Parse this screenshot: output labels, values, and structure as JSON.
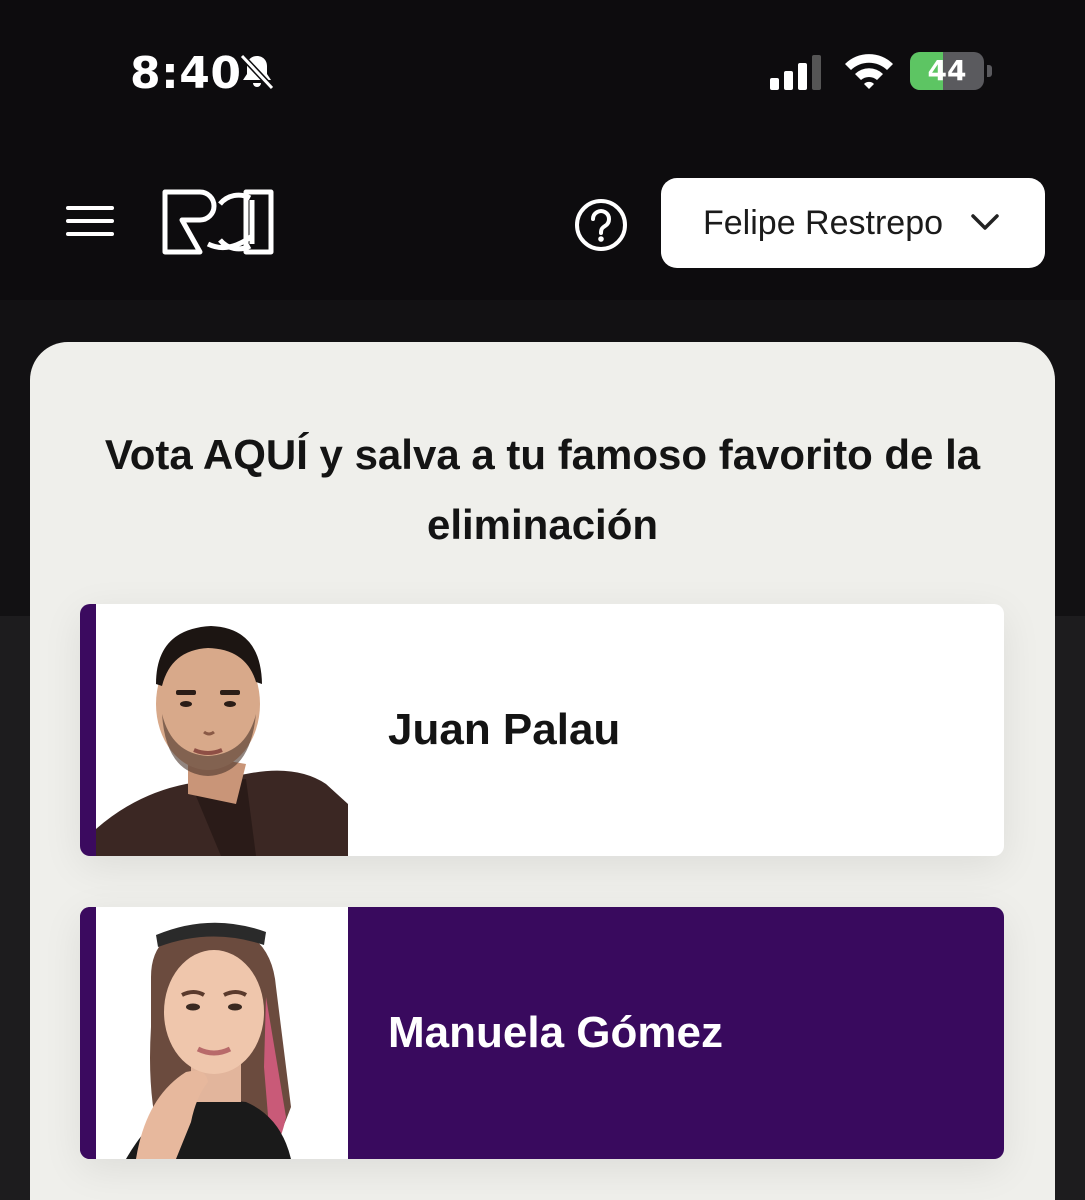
{
  "status_bar": {
    "time": "8:40",
    "battery_level": "44",
    "battery_fraction": 0.44
  },
  "header": {
    "user_name": "Felipe Restrepo"
  },
  "vote": {
    "title": "Vota AQUÍ y salva a tu famoso favorito de la eliminación",
    "candidates": [
      {
        "name": "Juan Palau",
        "selected": false
      },
      {
        "name": "Manuela Gómez",
        "selected": true
      }
    ]
  },
  "colors": {
    "accent": "#390a5e",
    "background": "#0d0c0e",
    "card": "#efefeb",
    "battery": "#5dc563"
  }
}
